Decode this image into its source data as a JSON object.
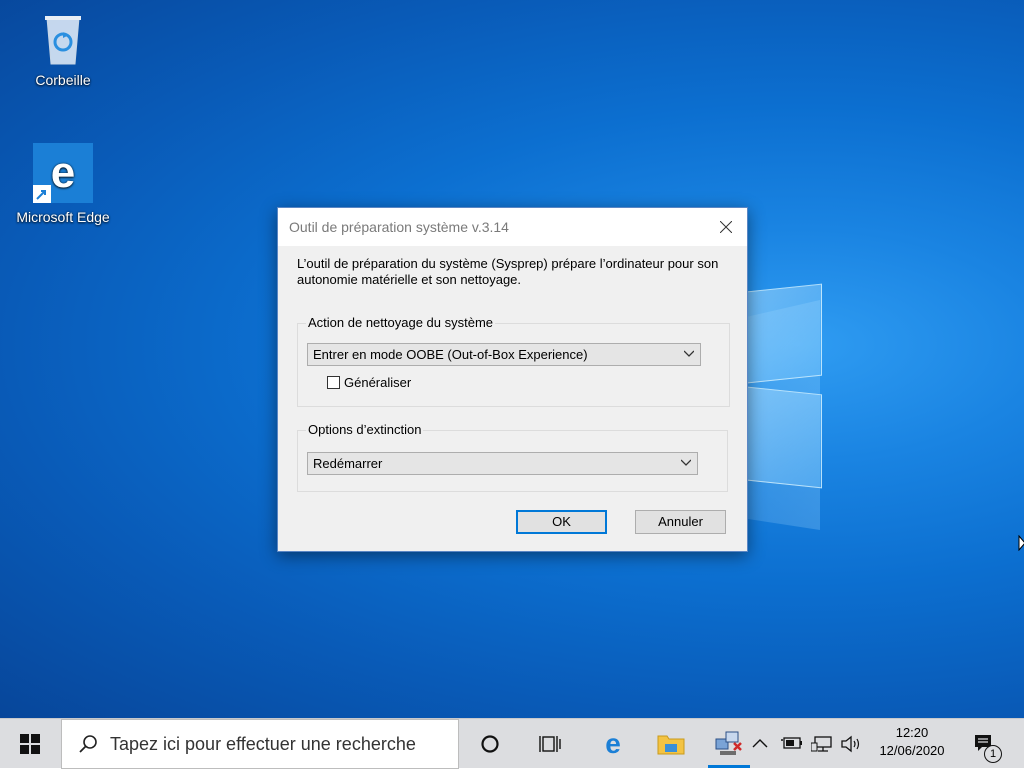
{
  "desktop": {
    "icons": [
      {
        "label": "Corbeille",
        "icon": "recycle-bin-icon"
      },
      {
        "label": "Microsoft Edge",
        "icon": "edge-icon"
      }
    ]
  },
  "dialog": {
    "title": "Outil de préparation système v.3.14",
    "description": "L’outil de préparation du système (Sysprep) prépare l’ordinateur pour son autonomie matérielle et son nettoyage.",
    "cleanup_group": {
      "label": "Action de nettoyage du système",
      "selected": "Entrer en mode OOBE (Out-of-Box Experience)",
      "generalize_label": "Généraliser",
      "generalize_checked": false
    },
    "shutdown_group": {
      "label": "Options d’extinction",
      "selected": "Redémarrer"
    },
    "ok_label": "OK",
    "cancel_label": "Annuler"
  },
  "taskbar": {
    "search_placeholder": "Tapez ici pour effectuer une recherche",
    "clock_time": "12:20",
    "clock_date": "12/06/2020",
    "notification_count": "1"
  },
  "colors": {
    "accent": "#0078d7",
    "desktop_blue": "#0c6fd0",
    "taskbar": "#dcdde0"
  }
}
